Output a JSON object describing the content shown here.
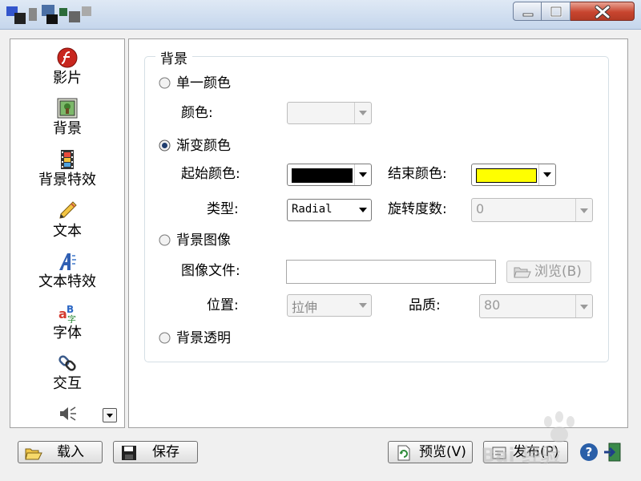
{
  "sidebar": {
    "items": [
      {
        "label": "影片",
        "icon": "flash-movie-icon"
      },
      {
        "label": "背景",
        "icon": "background-picture-icon"
      },
      {
        "label": "背景特效",
        "icon": "film-strip-icon"
      },
      {
        "label": "文本",
        "icon": "pencil-icon"
      },
      {
        "label": "文本特效",
        "icon": "text-effect-icon"
      },
      {
        "label": "字体",
        "icon": "font-icon"
      },
      {
        "label": "交互",
        "icon": "link-icon"
      },
      {
        "label": "",
        "icon": "speaker-icon"
      }
    ]
  },
  "background": {
    "group_title": "背景",
    "solid": {
      "label": "单一颜色",
      "color_label": "颜色:"
    },
    "gradient": {
      "label": "渐变颜色",
      "start_label": "起始颜色:",
      "start_color": "#000000",
      "end_label": "结束颜色:",
      "end_color": "#ffff00",
      "type_label": "类型:",
      "type_value": "Radial",
      "rotation_label": "旋转度数:",
      "rotation_value": "0"
    },
    "image": {
      "label": "背景图像",
      "file_label": "图像文件:",
      "file_value": "",
      "browse_label": "浏览(B)",
      "position_label": "位置:",
      "position_value": "拉伸",
      "quality_label": "品质:",
      "quality_value": "80"
    },
    "transparent": {
      "label": "背景透明"
    },
    "selected": "gradient"
  },
  "footer": {
    "load_label": "载入",
    "save_label": "保存",
    "preview_label": "预览(V)",
    "publish_label": "发布(P)"
  },
  "watermark": {
    "text": "Bai 经验"
  },
  "colors": {
    "accent": "#2a5fa8",
    "close": "#c8452f"
  }
}
